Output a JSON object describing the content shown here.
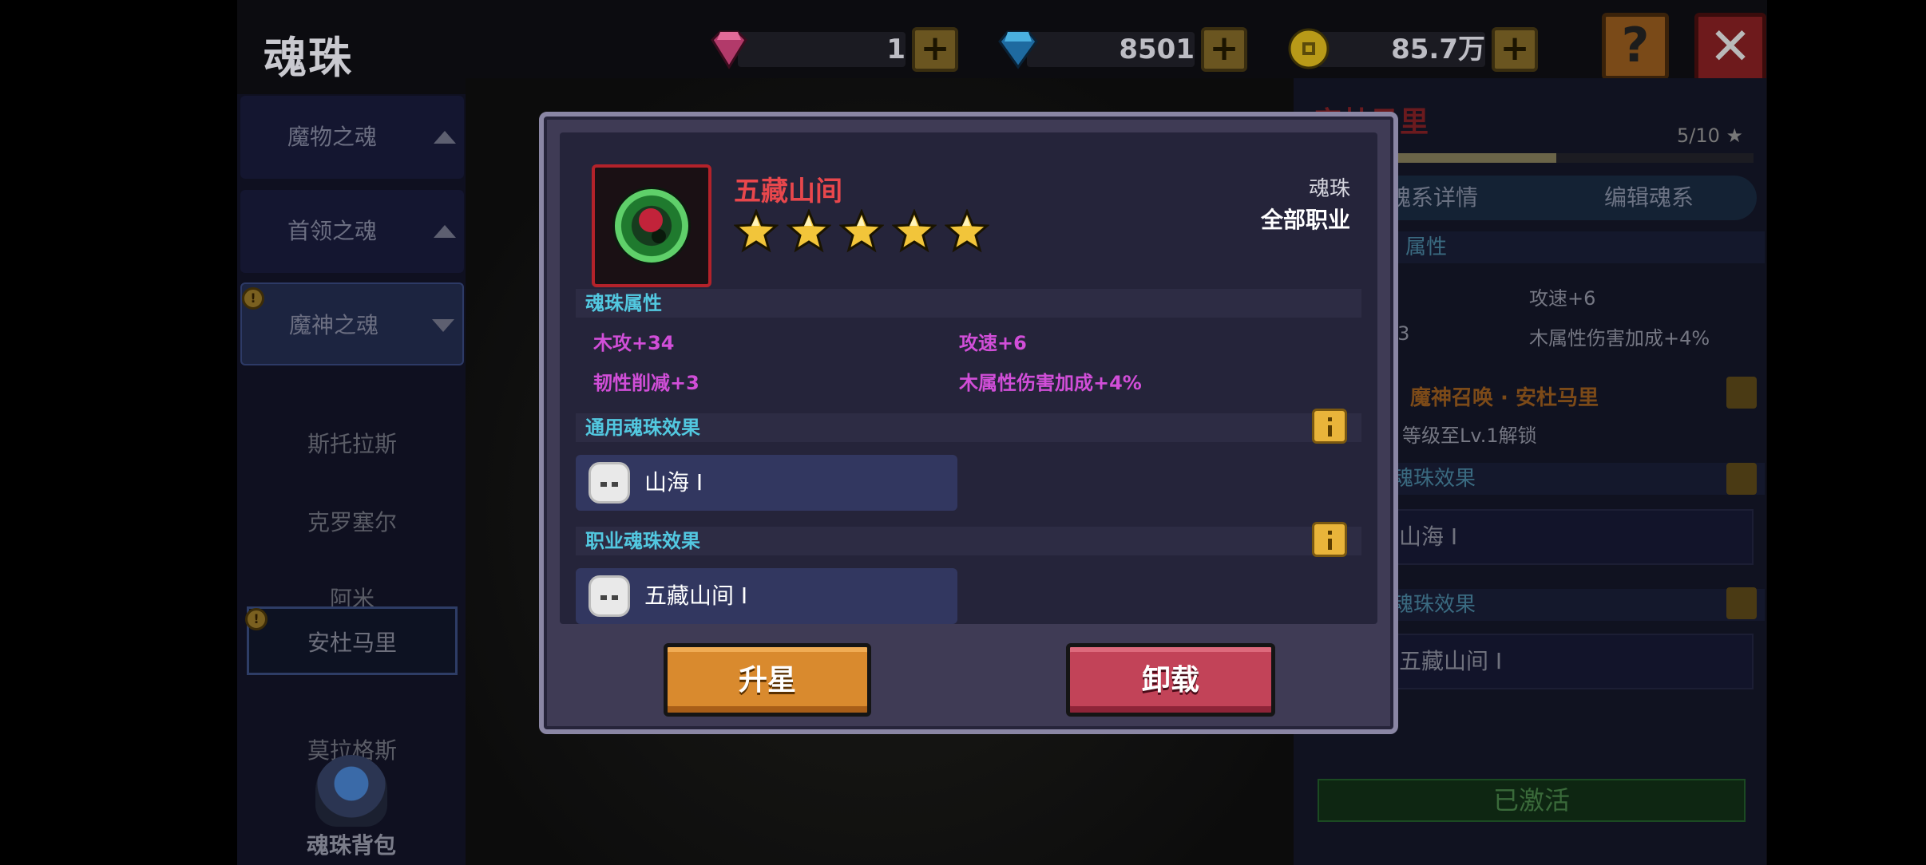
{
  "header": {
    "title": "魂珠"
  },
  "currencies": [
    {
      "name": "pink-gem",
      "value": "1",
      "color": "#e0507a"
    },
    {
      "name": "blue-diamond",
      "value": "8501",
      "color": "#3aa0e0"
    },
    {
      "name": "gold-coin",
      "value": "85.7万",
      "color": "#e0c020"
    }
  ],
  "controls": {
    "help": "?",
    "close": "✕"
  },
  "sidebar": {
    "categories": [
      {
        "label": "魔物之魂",
        "arrow": "up"
      },
      {
        "label": "首领之魂",
        "arrow": "up"
      },
      {
        "label": "魔神之魂",
        "arrow": "down"
      }
    ],
    "items": [
      "斯托拉斯",
      "克罗塞尔",
      "阿米",
      "安杜马里",
      "莫拉格斯"
    ],
    "selected": "安杜马里",
    "bag_label": "魂珠背包"
  },
  "right_panel": {
    "title": "安杜马里",
    "progress_text": "5/10 ★",
    "progress": 0.54,
    "tabs": [
      "魂系详情",
      "编辑魂系"
    ],
    "section_label": "属性",
    "rows": [
      [
        "攻速+6"
      ],
      [
        "+3",
        "木属性伤害加成+4%"
      ]
    ],
    "summon_title": "魔神召唤 · 安杜马里",
    "unlock_text": "等级至Lv.1解锁",
    "common_effect_head": "魂珠效果",
    "common_effect": "山海 Ⅰ",
    "job_effect_head": "魂珠效果",
    "job_effect": "五藏山间 Ⅰ",
    "status": "已激活"
  },
  "modal": {
    "item_name": "五藏山间",
    "stars": 5,
    "item_type": "魂珠",
    "item_job": "全部职业",
    "attributes_head": "魂珠属性",
    "attributes": [
      "木攻+34",
      "攻速+6",
      "韧性削减+3",
      "木属性伤害加成+4%"
    ],
    "common_effect_head": "通用魂珠效果",
    "common_effect": "山海 Ⅰ",
    "job_effect_head": "职业魂珠效果",
    "job_effect": "五藏山间 Ⅰ",
    "upgrade_label": "升星",
    "unequip_label": "卸载"
  },
  "colors": {
    "name_red": "#e8474c",
    "attr_purple": "#d14ed8",
    "section_cyan": "#52c8e0",
    "star_gold": "#f2c53a",
    "upgrade_orange": "#d98a2e",
    "unequip_red": "#c24358"
  }
}
